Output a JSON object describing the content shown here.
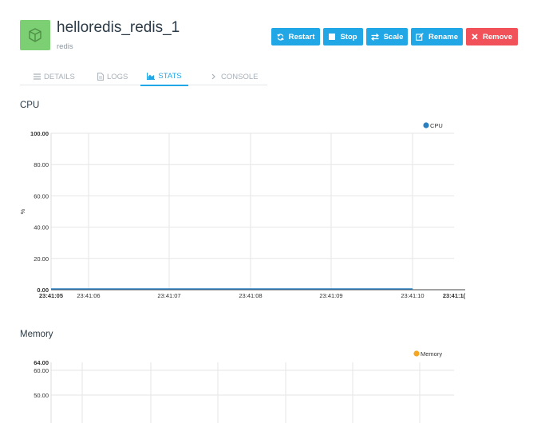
{
  "container": {
    "name": "helloredis_redis_1",
    "image": "redis"
  },
  "actions": {
    "restart": "Restart",
    "stop": "Stop",
    "scale": "Scale",
    "rename": "Rename",
    "remove": "Remove"
  },
  "tabs": [
    {
      "label": "DETAILS",
      "active": false
    },
    {
      "label": "LOGS",
      "active": false
    },
    {
      "label": "STATS",
      "active": true
    },
    {
      "label": "CONSOLE",
      "active": false
    }
  ],
  "cpu_section": {
    "title": "CPU"
  },
  "memory_section": {
    "title": "Memory"
  },
  "colors": {
    "accent": "#22a7e6",
    "danger": "#f1525a",
    "container_icon": "#7dcf73",
    "cpu_series": "#2a7fc0",
    "memory_series": "#f5a623"
  },
  "chart_data": [
    {
      "type": "line",
      "title": "",
      "ylabel": "%",
      "xlabel": "",
      "ylim": [
        0,
        100
      ],
      "yticks": [
        "100.00",
        "80.00",
        "60.00",
        "40.00",
        "20.00",
        "0.00"
      ],
      "ytick_values": [
        100,
        80,
        60,
        40,
        20,
        0
      ],
      "xticks": [
        "23:41:05",
        "23:41:06",
        "23:41:07",
        "23:41:08",
        "23:41:09",
        "23:41:10",
        "23:41:1("
      ],
      "xtick_bold": [
        true,
        false,
        false,
        false,
        false,
        false,
        true
      ],
      "legend_position": "top-right",
      "grid": true,
      "series": [
        {
          "name": "CPU",
          "x": [
            "23:41:05",
            "23:41:06",
            "23:41:07",
            "23:41:08",
            "23:41:09",
            "23:41:10"
          ],
          "values": [
            0,
            0,
            0,
            0,
            0,
            0
          ]
        }
      ]
    },
    {
      "type": "line",
      "title": "",
      "ylabel": "",
      "xlabel": "",
      "ylim": [
        50,
        64
      ],
      "yticks": [
        "64.00",
        "60.00",
        "50.00"
      ],
      "ytick_values": [
        64,
        60,
        50
      ],
      "ytick_bold": [
        true,
        false,
        false
      ],
      "legend_position": "top-right",
      "grid": true,
      "series": [
        {
          "name": "Memory",
          "values": []
        }
      ]
    }
  ]
}
